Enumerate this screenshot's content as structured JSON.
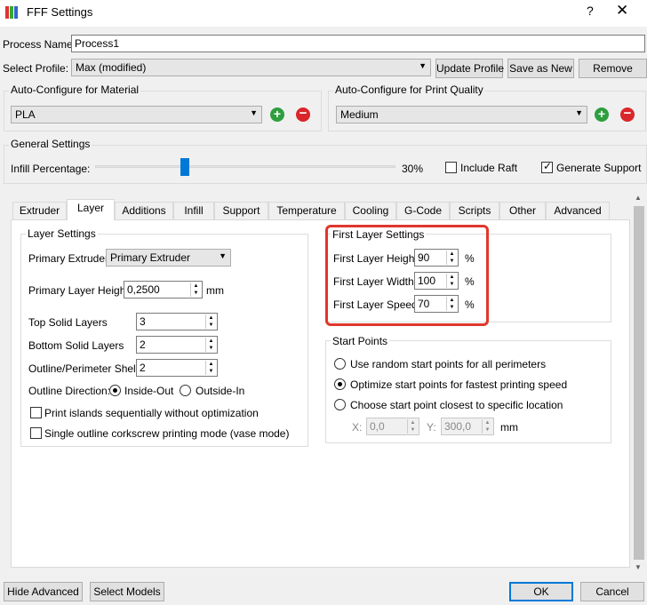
{
  "window": {
    "title": "FFF Settings",
    "help": "?",
    "close": "✕"
  },
  "process": {
    "label": "Process Name:",
    "value": "Process1"
  },
  "profile": {
    "label": "Select Profile:",
    "value": "Max (modified)",
    "update": "Update Profile",
    "save_as_new": "Save as New",
    "remove": "Remove"
  },
  "auto_material": {
    "title": "Auto-Configure for Material",
    "value": "PLA"
  },
  "auto_quality": {
    "title": "Auto-Configure for Print Quality",
    "value": "Medium"
  },
  "general": {
    "title": "General Settings",
    "infill_label": "Infill Percentage:",
    "infill_value": "30%",
    "infill_level": 0.3,
    "include_raft": "Include Raft",
    "generate_support": "Generate Support"
  },
  "tabs": [
    "Extruder",
    "Layer",
    "Additions",
    "Infill",
    "Support",
    "Temperature",
    "Cooling",
    "G-Code",
    "Scripts",
    "Other",
    "Advanced"
  ],
  "layer_settings": {
    "title": "Layer Settings",
    "primary_extruder_label": "Primary Extruder",
    "primary_extruder_value": "Primary Extruder",
    "layer_height_label": "Primary Layer Height",
    "layer_height_value": "0,2500",
    "layer_height_unit": "mm",
    "top_solid_label": "Top Solid Layers",
    "top_solid_value": "3",
    "bottom_solid_label": "Bottom Solid Layers",
    "bottom_solid_value": "2",
    "shells_label": "Outline/Perimeter Shells",
    "shells_value": "2",
    "direction_label": "Outline Direction:",
    "inside_out": "Inside-Out",
    "outside_in": "Outside-In",
    "print_islands": "Print islands sequentially without optimization",
    "vase_mode": "Single outline corkscrew printing mode (vase mode)"
  },
  "first_layer": {
    "title": "First Layer Settings",
    "height_label": "First Layer Height",
    "height_value": "90",
    "width_label": "First Layer Width",
    "width_value": "100",
    "speed_label": "First Layer Speed",
    "speed_value": "70",
    "unit": "%"
  },
  "start_points": {
    "title": "Start Points",
    "random": "Use random start points for all perimeters",
    "optimize": "Optimize start points for fastest printing speed",
    "closest": "Choose start point closest to specific location",
    "x_label": "X:",
    "x_value": "0,0",
    "y_label": "Y:",
    "y_value": "300,0",
    "unit": "mm"
  },
  "footer": {
    "hide_advanced": "Hide Advanced",
    "select_models": "Select Models",
    "ok": "OK",
    "cancel": "Cancel"
  },
  "colors": {
    "accent": "#0078d7",
    "highlight": "#e0372c",
    "add": "#2e9e3f",
    "remove": "#d9262a"
  }
}
